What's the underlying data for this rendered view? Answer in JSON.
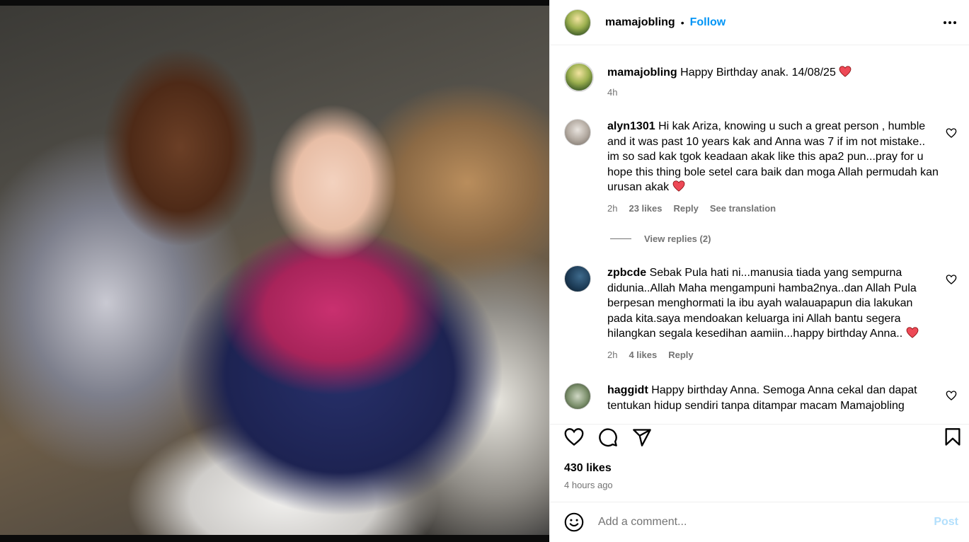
{
  "post": {
    "username": "mamajobling",
    "separator": "•",
    "follow_label": "Follow",
    "caption": "Happy Birthday anak. 14/08/25",
    "caption_time": "4h"
  },
  "comments": [
    {
      "user": "alyn1301",
      "text": "Hi kak Ariza, knowing u such a great person , humble and it was past 10 years kak and Anna was 7 if im not mistake.. im so sad kak tgok keadaan akak like this apa2 pun...pray for u hope this thing bole setel cara baik dan moga Allah permudah kan urusan akak",
      "time": "2h",
      "likes": "23 likes",
      "reply": "Reply",
      "translate": "See translation",
      "view_replies": "View replies (2)"
    },
    {
      "user": "zpbcde",
      "text": "Sebak Pula hati ni...manusia tiada yang sempurna didunia..Allah Maha mengampuni hamba2nya..dan Allah Pula berpesan menghormati la ibu ayah walauapapun dia lakukan pada kita.saya mendoakan keluarga ini Allah bantu segera hilangkan segala kesedihan aamiin...happy birthday Anna..",
      "time": "2h",
      "likes": "4 likes",
      "reply": "Reply"
    },
    {
      "user": "haggidt",
      "text": "Happy birthday Anna. Semoga Anna cekal dan dapat tentukan hidup sendiri tanpa ditampar macam Mamajobling"
    }
  ],
  "footer": {
    "likes": "430 likes",
    "time": "4 hours ago",
    "comment_placeholder": "Add a comment...",
    "post_label": "Post"
  },
  "icons": {
    "heart_color": "#ed4956",
    "accent": "#0095f6"
  }
}
